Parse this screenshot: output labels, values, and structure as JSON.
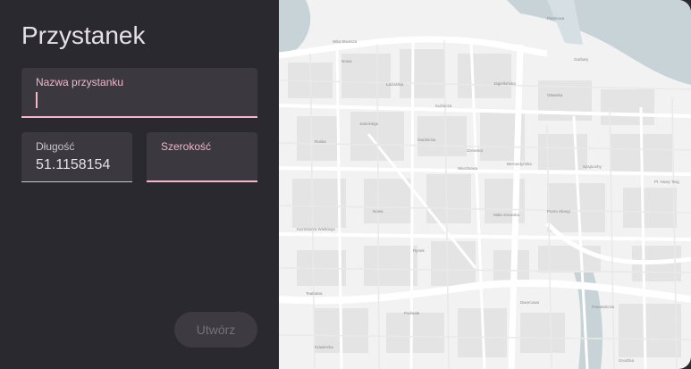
{
  "dialog": {
    "title": "Przystanek",
    "fields": {
      "name": {
        "label": "Nazwa przystanku",
        "value": ""
      },
      "longitude": {
        "label": "Długość",
        "value": "51.1158154"
      },
      "latitude": {
        "label": "Szerokość",
        "value": ""
      }
    },
    "create_button": "Utwórz"
  },
  "map": {
    "street_labels": [
      "Wita Stwosza",
      "Kazimierza Wielkiego",
      "Świdnicka",
      "Ruska",
      "Oławska",
      "Szewska",
      "Nowa",
      "Piaskowa",
      "Pl. Nowy Targ",
      "Mała Szewska",
      "Powstańców",
      "Dworcowa",
      "Teatralna",
      "Piotra Skargi",
      "Podwale",
      "Grodzka",
      "Szajnochy",
      "Kuźnicza",
      "Łaciarska",
      "Wierzbowa",
      "Janickiego",
      "Bernardyńska",
      "Garbary",
      "Krawiecka",
      "Rynek",
      "Jagiellońska",
      "Nowa"
    ]
  },
  "colors": {
    "panel_bg": "#2b2930",
    "field_bg": "#3b3840",
    "accent": "#f2b8c6",
    "text": "#e6e0e9",
    "map_bg": "#f2f2f2",
    "water": "#c8d3d8"
  }
}
